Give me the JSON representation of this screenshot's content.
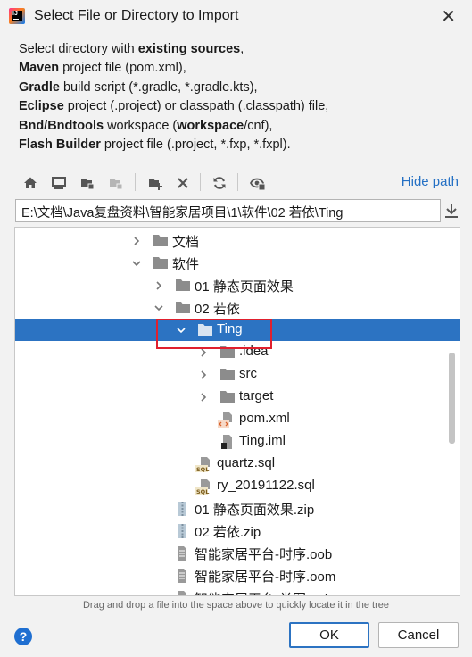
{
  "window": {
    "title": "Select File or Directory to Import",
    "close_glyph": "✕"
  },
  "description": {
    "lines": [
      [
        {
          "t": "Select directory with ",
          "b": false
        },
        {
          "t": "existing sources",
          "b": true
        },
        {
          "t": ",",
          "b": false
        }
      ],
      [
        {
          "t": "Maven",
          "b": true
        },
        {
          "t": " project file (pom.xml),",
          "b": false
        }
      ],
      [
        {
          "t": "Gradle",
          "b": true
        },
        {
          "t": " build script (*.gradle, *.gradle.kts),",
          "b": false
        }
      ],
      [
        {
          "t": "Eclipse",
          "b": true
        },
        {
          "t": " project (.project) or classpath (.classpath) file,",
          "b": false
        }
      ],
      [
        {
          "t": "Bnd/Bndtools",
          "b": true
        },
        {
          "t": " workspace (",
          "b": false
        },
        {
          "t": "workspace",
          "b": true
        },
        {
          "t": "/cnf),",
          "b": false
        }
      ],
      [
        {
          "t": "Flash Builder",
          "b": true
        },
        {
          "t": " project file (.project, *.fxp, *.fxpl).",
          "b": false
        }
      ]
    ]
  },
  "toolbar": {
    "buttons": [
      "home-icon",
      "desktop-icon",
      "project-folder-icon",
      "module-folder-icon",
      "new-folder-icon",
      "delete-icon",
      "refresh-icon",
      "show-hidden-icon"
    ],
    "hide_path_label": "Hide path"
  },
  "path": {
    "value": "E:\\文档\\Java复盘资料\\智能家居项目\\1\\软件\\02 若依\\Ting"
  },
  "tree": [
    {
      "label": "文档",
      "indent": 0,
      "arrow": "right",
      "icon": "folder",
      "selected": false
    },
    {
      "label": "软件",
      "indent": 0,
      "arrow": "down",
      "icon": "folder",
      "selected": false
    },
    {
      "label": "01 静态页面效果",
      "indent": 1,
      "arrow": "right",
      "icon": "folder",
      "selected": false
    },
    {
      "label": "02 若依",
      "indent": 1,
      "arrow": "down",
      "icon": "folder",
      "selected": false
    },
    {
      "label": "Ting",
      "indent": 2,
      "arrow": "down",
      "icon": "folder",
      "selected": true
    },
    {
      "label": ".idea",
      "indent": 3,
      "arrow": "right",
      "icon": "folder",
      "selected": false
    },
    {
      "label": "src",
      "indent": 3,
      "arrow": "right",
      "icon": "folder",
      "selected": false
    },
    {
      "label": "target",
      "indent": 3,
      "arrow": "right",
      "icon": "folder",
      "selected": false
    },
    {
      "label": "pom.xml",
      "indent": 3,
      "arrow": "none",
      "icon": "xml",
      "selected": false
    },
    {
      "label": "Ting.iml",
      "indent": 3,
      "arrow": "none",
      "icon": "iml",
      "selected": false
    },
    {
      "label": "quartz.sql",
      "indent": 2,
      "arrow": "none",
      "icon": "sql",
      "selected": false
    },
    {
      "label": "ry_20191122.sql",
      "indent": 2,
      "arrow": "none",
      "icon": "sql",
      "selected": false
    },
    {
      "label": "01 静态页面效果.zip",
      "indent": 1,
      "arrow": "none",
      "icon": "zip",
      "selected": false
    },
    {
      "label": "02 若依.zip",
      "indent": 1,
      "arrow": "none",
      "icon": "zip",
      "selected": false
    },
    {
      "label": "智能家居平台-时序.oob",
      "indent": 1,
      "arrow": "none",
      "icon": "file",
      "selected": false
    },
    {
      "label": "智能家居平台-时序.oom",
      "indent": 1,
      "arrow": "none",
      "icon": "file",
      "selected": false
    },
    {
      "label": "智能家居平台-类图.oob",
      "indent": 1,
      "arrow": "none",
      "icon": "file",
      "selected": false
    }
  ],
  "hint": "Drag and drop a file into the space above to quickly locate it in the tree",
  "buttons": {
    "help": "?",
    "ok": "OK",
    "cancel": "Cancel"
  },
  "colors": {
    "selection": "#2c73c2",
    "link": "#2470c4",
    "highlight_box": "#e0202e"
  }
}
